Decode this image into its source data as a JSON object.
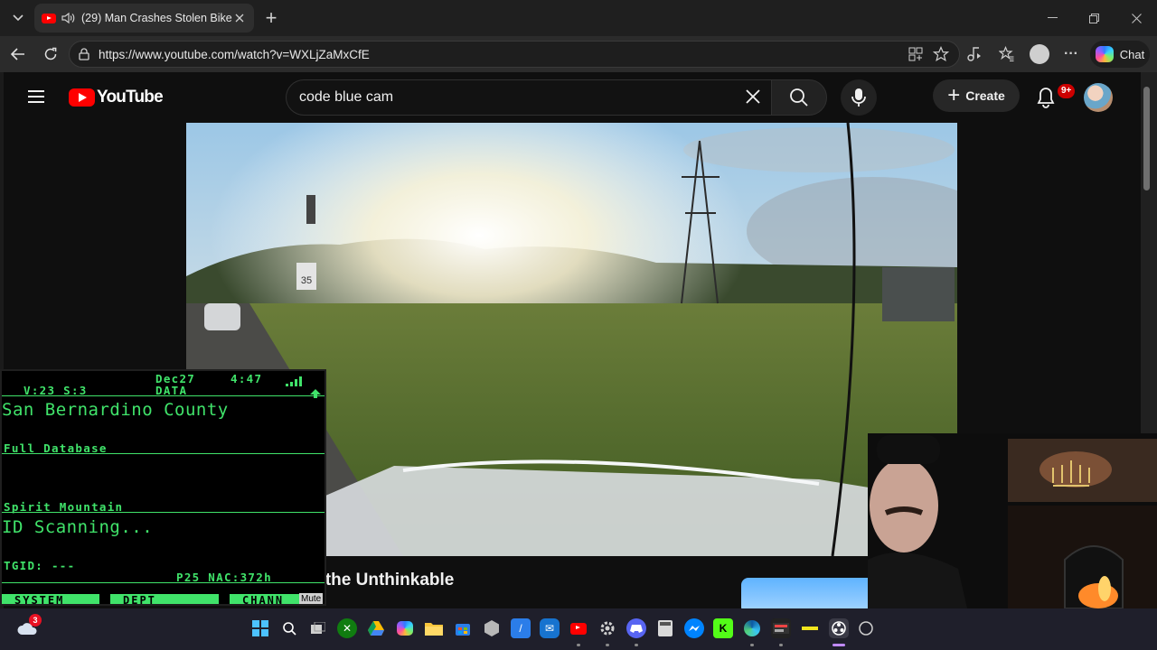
{
  "browser": {
    "tab": {
      "title": "(29) Man Crashes Stolen Bike"
    },
    "new_tab_label": "+",
    "address": "https://www.youtube.com/watch?v=WXLjZaMxCfE",
    "chat_label": "Chat"
  },
  "youtube": {
    "logo_text": "YouTube",
    "search": {
      "value": "code blue cam"
    },
    "create_label": "Create",
    "notifications_badge": "9+",
    "video_title_fragment": "s the Unthinkable",
    "video_sign": "35"
  },
  "scanner": {
    "status_left": "V:23  S:3",
    "date": "Dec27",
    "time": "4:47",
    "mode": "DATA",
    "county": "San Bernardino County",
    "database": "Full Database",
    "channel": "Spirit Mountain",
    "scan_status": "ID Scanning...",
    "tgid": "TGID: ---",
    "p25": "P25 NAC:372h",
    "tabs": [
      "SYSTEM",
      "DEPT",
      "CHANN"
    ],
    "mute_label": "Mute"
  },
  "taskbar": {
    "weather_badge": "3",
    "colors": {
      "accent": "#ff0000",
      "scanner_green": "#40e36a"
    }
  }
}
